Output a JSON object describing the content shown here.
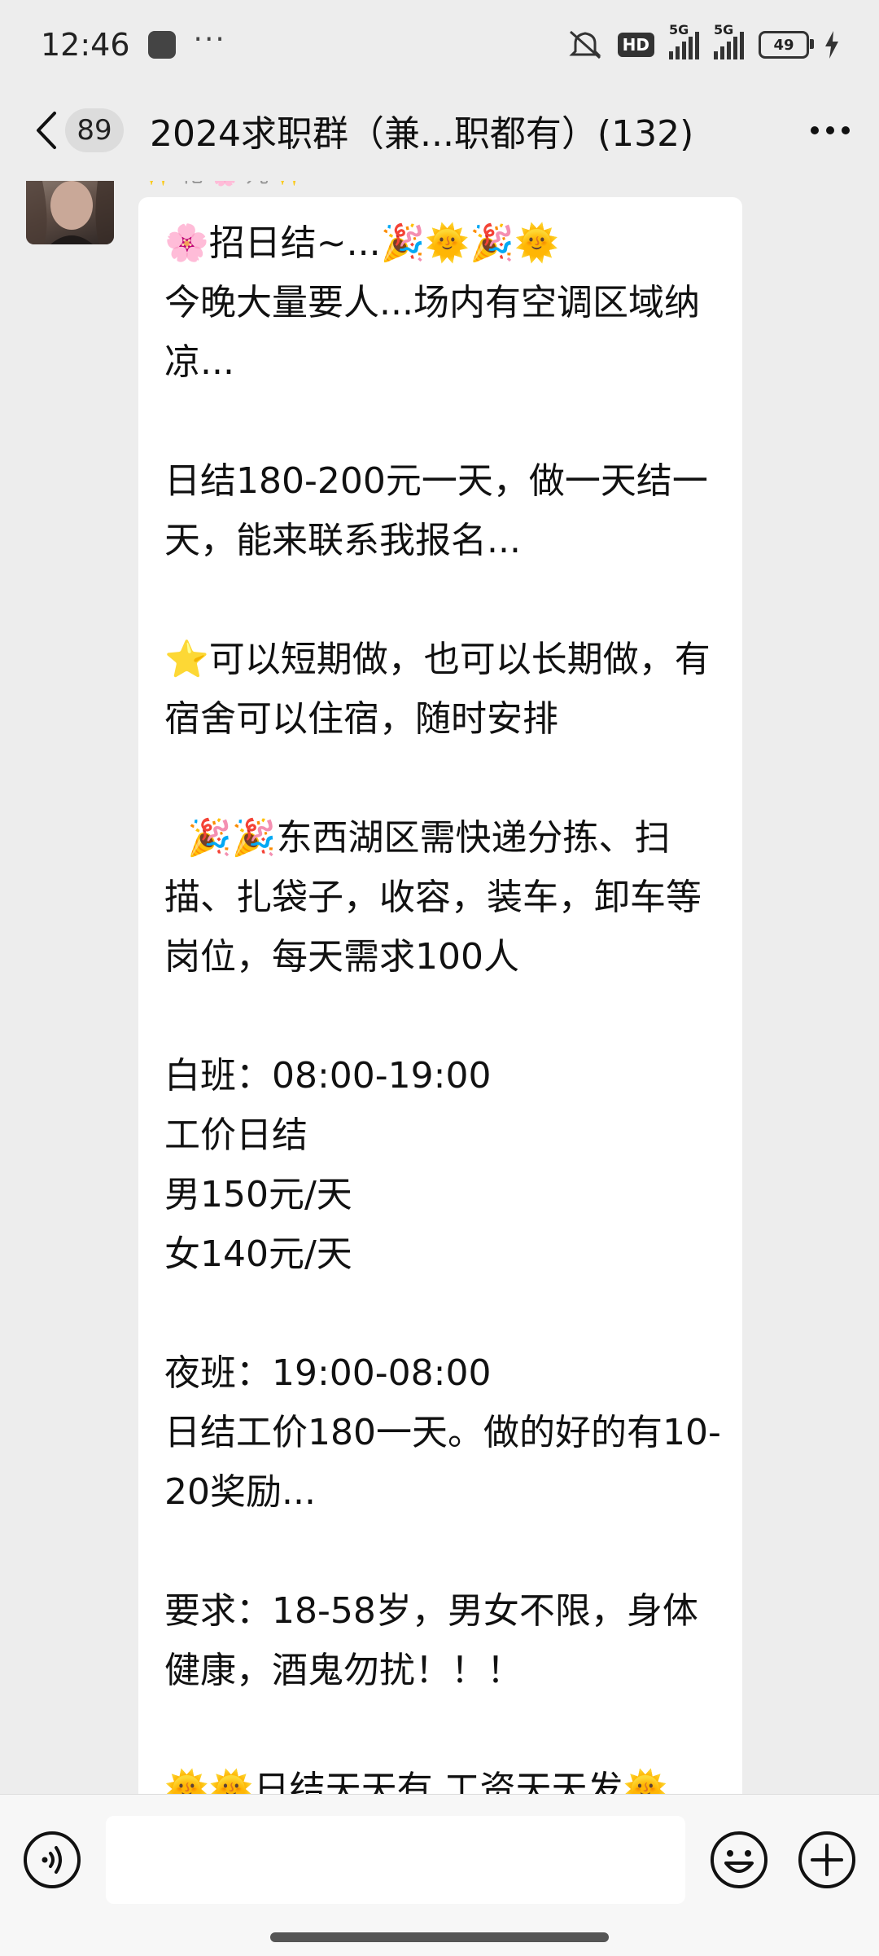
{
  "status_bar": {
    "time": "12:46",
    "dots": "···",
    "hd": "HD",
    "signal_1": "5G",
    "signal_2": "5G",
    "battery": "49"
  },
  "header": {
    "unread_count": "89",
    "title": "2024求职群（兼...职都有）(132)"
  },
  "message": {
    "sender": "✨ 花 🌸 儿 ✨",
    "text": "🌸招日结~...🎉🌞🎉🌞\n今晚大量要人...场内有空调区域纳凉...\n\n日结180-200元一天，做一天结一天，能来联系我报名...\n\n⭐可以短期做，也可以长期做，有宿舍可以住宿，随时安排\n\n  🎉🎉东西湖区需快递分拣、扫描、扎袋子，收容，装车，卸车等岗位，每天需求100人\n\n白班：08:00-19:00\n工价日结\n男150元/天\n女140元/天\n\n夜班：19:00-08:00\n日结工价180一天。做的好的有10-20奖励...\n\n要求：18-58岁，男女不限，身体健康，酒鬼勿扰！！！\n\n🌞🌞日结天天有 工资天天发🌞\n🌞"
  },
  "input": {
    "value": "",
    "placeholder": ""
  }
}
